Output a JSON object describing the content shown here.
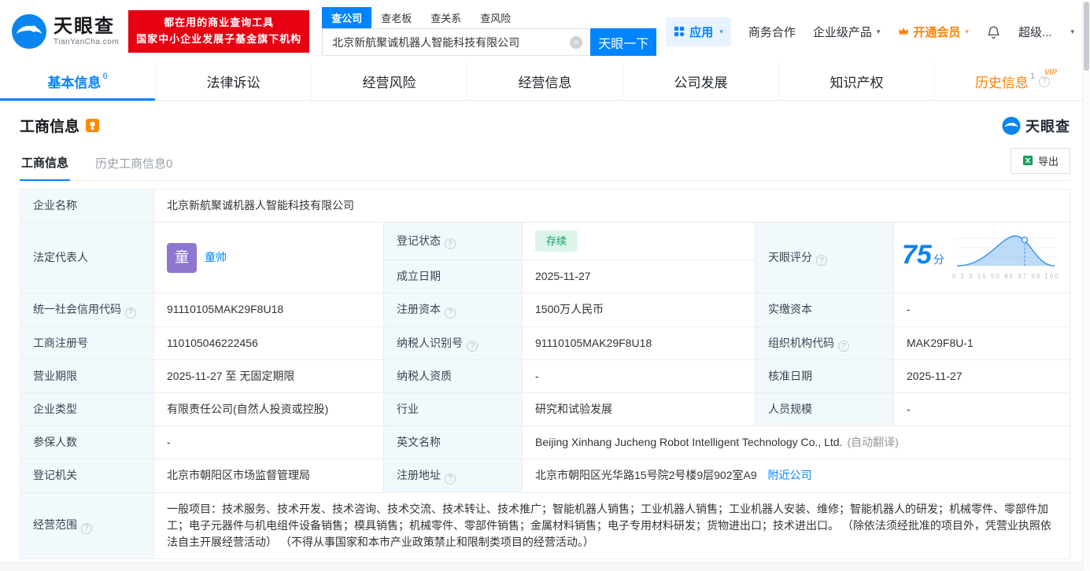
{
  "colors": {
    "accent_blue": "#0084ff",
    "brand_red": "#e60012",
    "vip_orange": "#ff8000",
    "status_green": "#00a661",
    "score_blue": "#0b82f7",
    "avatar_purple": "#8e77d0",
    "label_cell_bg": "#f2f9fd"
  },
  "icons": {
    "question": "?",
    "clear": "×",
    "caret": "▾"
  },
  "header": {
    "logo": {
      "title": "天眼查",
      "subtitle": "TianYanCha.com"
    },
    "promo": {
      "line1": "都在用的商业查询工具",
      "line2": "国家中小企业发展子基金旗下机构"
    },
    "search": {
      "tabs": [
        {
          "label": "查公司"
        },
        {
          "label": "查老板"
        },
        {
          "label": "查关系"
        },
        {
          "label": "查风险"
        }
      ],
      "value": "北京新航聚诚机器人智能科技有限公司",
      "button": "天眼一下"
    },
    "nav": {
      "apps": "应用",
      "cooperation": "商务合作",
      "enterprise": "企业级产品",
      "vip": "开通会员",
      "super": "超级..."
    }
  },
  "tabs": [
    {
      "label": "基本信息",
      "badge": "6"
    },
    {
      "label": "法律诉讼",
      "badge": ""
    },
    {
      "label": "经营风险",
      "badge": ""
    },
    {
      "label": "经营信息",
      "badge": ""
    },
    {
      "label": "公司发展",
      "badge": ""
    },
    {
      "label": "知识产权",
      "badge": ""
    },
    {
      "label": "历史信息",
      "badge": "1",
      "vip": "VIP"
    }
  ],
  "section": {
    "title": "工商信息",
    "brand": "天眼查",
    "subtabs": [
      {
        "label": "工商信息"
      },
      {
        "label": "历史工商信息0"
      }
    ],
    "export": "导出"
  },
  "info": {
    "company_name_label": "企业名称",
    "company_name": "北京新航聚诚机器人智能科技有限公司",
    "legal_rep_label": "法定代表人",
    "legal_rep_avatar": "童",
    "legal_rep": "童帅",
    "reg_status_label": "登记状态",
    "reg_status": "存续",
    "score_label": "天眼评分",
    "score": "75",
    "score_unit": "分",
    "score_ticks": "0 1 3 15 50 85 97 99 100",
    "est_date_label": "成立日期",
    "est_date": "2025-11-27",
    "credit_code_label": "统一社会信用代码",
    "credit_code": "91110105MAK29F8U18",
    "reg_capital_label": "注册资本",
    "reg_capital": "1500万人民币",
    "paid_capital_label": "实缴资本",
    "paid_capital": "-",
    "reg_number_label": "工商注册号",
    "reg_number": "110105046222456",
    "taxpayer_id_label": "纳税人识别号",
    "taxpayer_id": "91110105MAK29F8U18",
    "org_code_label": "组织机构代码",
    "org_code": "MAK29F8U-1",
    "biz_term_label": "营业期限",
    "biz_term": "2025-11-27 至 无固定期限",
    "taxpayer_quality_label": "纳税人资质",
    "taxpayer_quality": "-",
    "approval_date_label": "核准日期",
    "approval_date": "2025-11-27",
    "company_type_label": "企业类型",
    "company_type": "有限责任公司(自然人投资或控股)",
    "industry_label": "行业",
    "industry": "研究和试验发展",
    "staff_size_label": "人员规模",
    "staff_size": "-",
    "insured_label": "参保人数",
    "insured": "-",
    "english_name_label": "英文名称",
    "english_name": "Beijing Xinhang Jucheng Robot Intelligent Technology Co., Ltd.",
    "english_name_note": "(自动翻译)",
    "reg_authority_label": "登记机关",
    "reg_authority": "北京市朝阳区市场监督管理局",
    "address_label": "注册地址",
    "address": "北京市朝阳区光华路15号院2号楼9层902室A9",
    "address_nearby": "附近公司",
    "biz_scope_label": "经营范围",
    "biz_scope": "一般项目：技术服务、技术开发、技术咨询、技术交流、技术转让、技术推广；智能机器人销售；工业机器人销售；工业机器人安装、维修；智能机器人的研发；机械零件、零部件加工；电子元器件与机电组件设备销售；模具销售；机械零件、零部件销售；金属材料销售；电子专用材料研发；货物进出口；技术进出口。 （除依法须经批准的项目外，凭营业执照依法自主开展经营活动） （不得从事国家和本市产业政策禁止和限制类项目的经营活动。）"
  }
}
